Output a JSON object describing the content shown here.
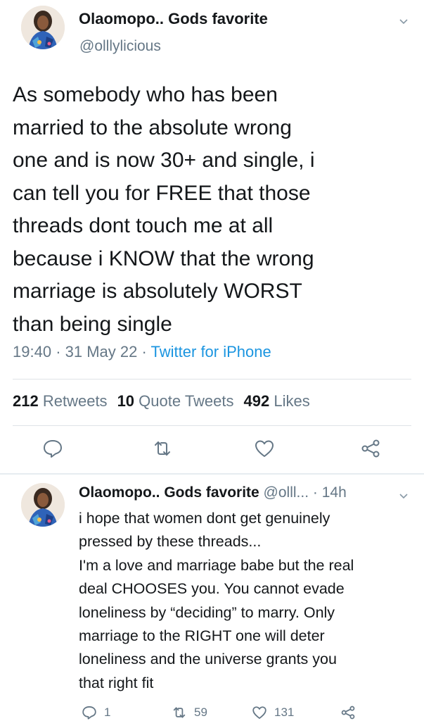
{
  "tweet": {
    "author_name": "Olaomopo.. Gods favorite",
    "handle": "@olllylicious",
    "text": "As somebody who has been\nmarried to the absolute wrong\none and is now 30+ and single, i\ncan tell you for FREE that those\nthreads dont touch me at all\nbecause i KNOW that the wrong\nmarriage is absolutely WORST\nthan being single",
    "time": "19:40",
    "date": "31 May 22",
    "source": "Twitter for iPhone",
    "retweets_count": "212",
    "retweets_label": "Retweets",
    "quotes_count": "10",
    "quotes_label": "Quote Tweets",
    "likes_count": "492",
    "likes_label": "Likes"
  },
  "reply": {
    "author_name": "Olaomopo.. Gods favorite",
    "handle": "@olll...",
    "time_ago": "14h",
    "text": "i hope that women dont get genuinely\npressed by these threads...\nI'm a love and marriage babe but the real\ndeal CHOOSES you. You cannot evade\nloneliness by “deciding” to marry. Only\nmarriage to the RIGHT one will deter\nloneliness and the universe grants you\nthat right fit",
    "replies_count": "1",
    "retweets_count": "59",
    "likes_count": "131"
  },
  "icons": {
    "menu": "chevron-down-icon",
    "reply": "reply-bubble-icon",
    "retweet": "retweet-icon",
    "like": "heart-icon",
    "share": "share-icon"
  },
  "colors": {
    "text": "#14171a",
    "secondary": "#657786",
    "link": "#1b95e0",
    "divider": "#e6ecf0"
  }
}
